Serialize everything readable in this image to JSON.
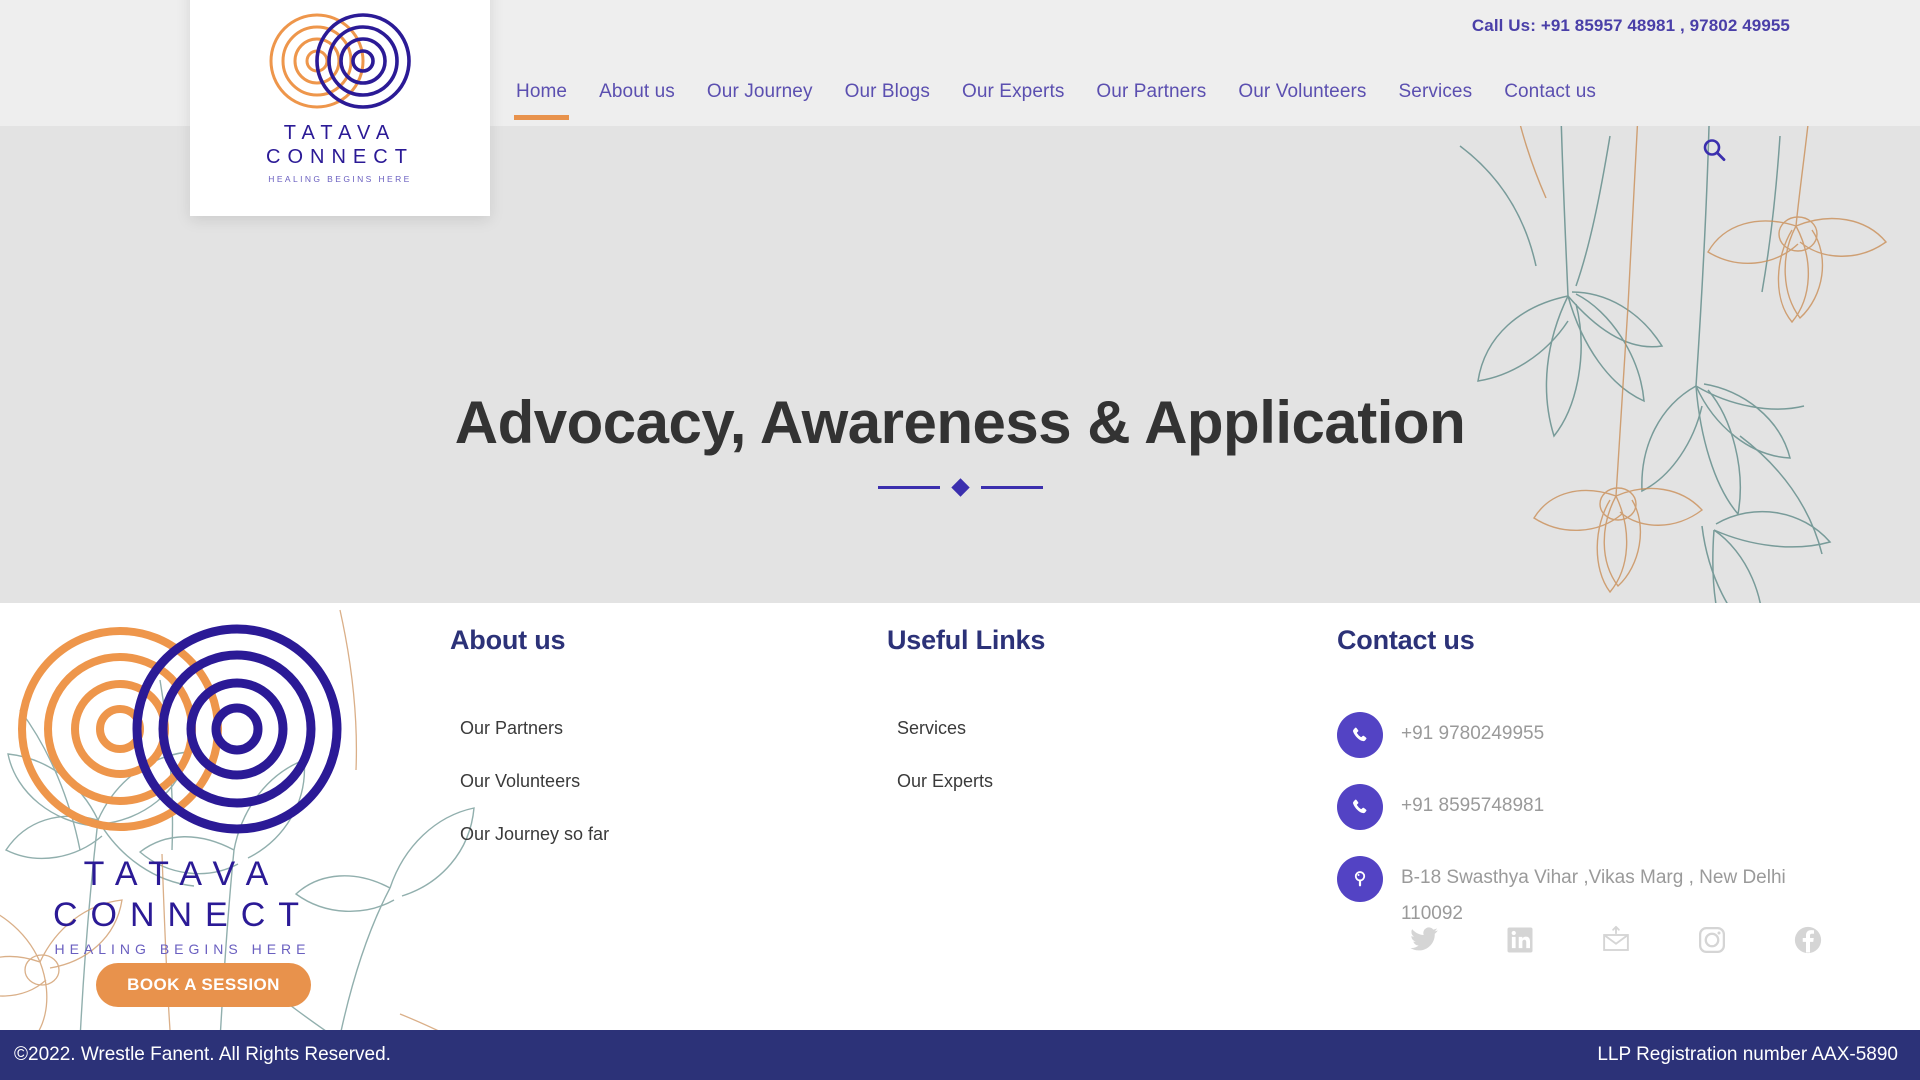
{
  "header": {
    "call_us": "Call Us: +91 85957 48981 , 97802 49955",
    "search_icon": "search-icon",
    "nav": [
      {
        "label": "Home",
        "active": true
      },
      {
        "label": "About us",
        "active": false
      },
      {
        "label": "Our Journey",
        "active": false
      },
      {
        "label": "Our Blogs",
        "active": false
      },
      {
        "label": "Our Experts",
        "active": false
      },
      {
        "label": "Our Partners",
        "active": false
      },
      {
        "label": "Our Volunteers",
        "active": false
      },
      {
        "label": "Services",
        "active": false
      },
      {
        "label": "Contact us",
        "active": false
      }
    ]
  },
  "logo": {
    "line1": "TATAVA",
    "line2": "CONNECT",
    "tagline": "HEALING BEGINS HERE",
    "mark_icon": "concentric-circles-logo-icon"
  },
  "hero": {
    "title": "Advocacy, Awareness & Application",
    "divider_icon": "diamond-divider-icon"
  },
  "footer": {
    "book_button": "BOOK A SESSION",
    "about": {
      "heading": "About us",
      "links": [
        "Our Partners",
        "Our Volunteers",
        "Our Journey so far"
      ]
    },
    "useful": {
      "heading": "Useful Links",
      "links": [
        "Services",
        "Our Experts"
      ]
    },
    "contact": {
      "heading": "Contact us",
      "items": [
        {
          "icon": "phone-icon",
          "text": "+91 9780249955"
        },
        {
          "icon": "phone-icon",
          "text": "+91 8595748981"
        },
        {
          "icon": "location-pin-icon",
          "text": "B-18 Swasthya Vihar ,Vikas Marg , New Delhi 110092"
        }
      ]
    },
    "socials": [
      {
        "icon": "twitter-icon",
        "name": "Twitter"
      },
      {
        "icon": "linkedin-icon",
        "name": "LinkedIn"
      },
      {
        "icon": "email-icon",
        "name": "Email"
      },
      {
        "icon": "instagram-icon",
        "name": "Instagram"
      },
      {
        "icon": "facebook-icon",
        "name": "Facebook"
      }
    ]
  },
  "bottom": {
    "copyright": "©2022. Wrestle Fanent. All Rights Reserved.",
    "llp": "LLP Registration number AAX-5890"
  },
  "colors": {
    "nav_text": "#5b4fb0",
    "accent_orange": "#e8924c",
    "navy": "#2c3278",
    "logo_purple": "#2b1a96",
    "icon_purple": "#5343c4",
    "hero_bg": "#e3e3e3",
    "header_bg": "#eeeeee",
    "social_gray": "#d5d5d5"
  }
}
